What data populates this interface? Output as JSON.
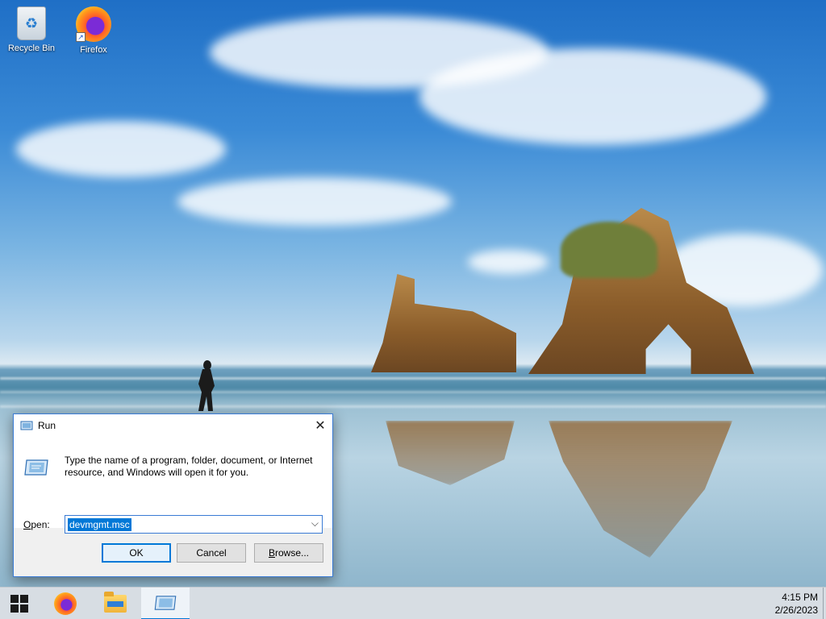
{
  "desktop": {
    "icons": [
      {
        "label": "Recycle Bin",
        "icon": "recycle-bin-icon"
      },
      {
        "label": "Firefox",
        "icon": "firefox-icon"
      }
    ]
  },
  "dialog": {
    "title": "Run",
    "description": "Type the name of a program, folder, document, or Internet resource, and Windows will open it for you.",
    "open_label_prefix": "",
    "open_label_underlined": "O",
    "open_label_rest": "pen:",
    "open_value": "devmgmt.msc",
    "buttons": {
      "ok": "OK",
      "cancel": "Cancel",
      "browse_underlined": "B",
      "browse_rest": "rowse..."
    }
  },
  "taskbar": {
    "items": [
      "start-button",
      "firefox",
      "file-explorer",
      "run"
    ],
    "time": "4:15 PM",
    "date": "2/26/2023"
  },
  "colors": {
    "accent": "#0078d7",
    "taskbar": "#d7dde3",
    "dialog_bg": "#f0f0f0"
  }
}
